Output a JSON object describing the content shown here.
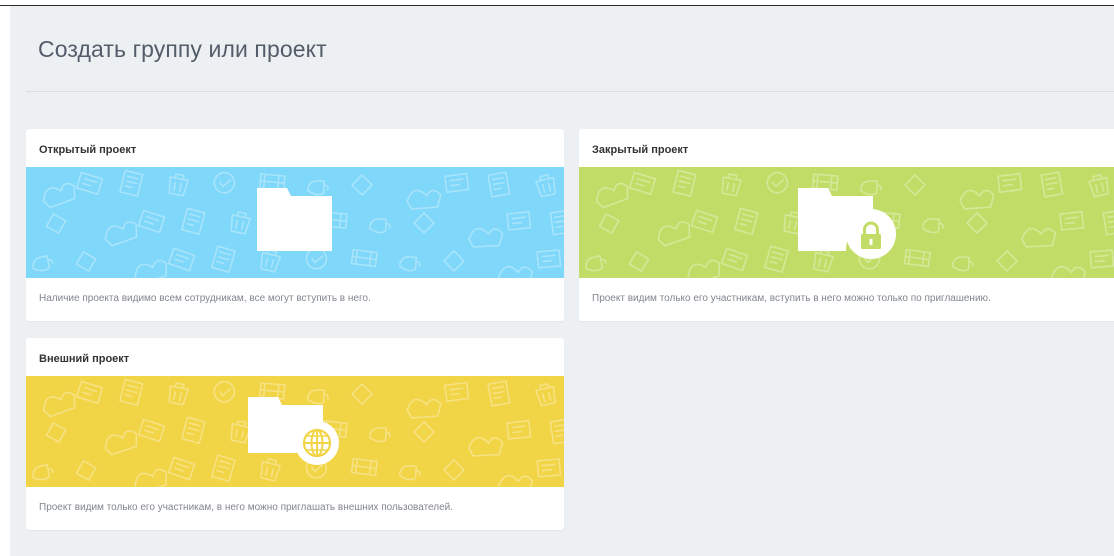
{
  "page": {
    "title": "Создать группу или проект"
  },
  "cards": [
    {
      "title": "Открытый проект",
      "description": "Наличие проекта видимо всем сотрудникам, все могут вступить в него.",
      "banner_color": "#7fd7f9",
      "icon": "folder-icon"
    },
    {
      "title": "Закрытый проект",
      "description": "Проект видим только его участникам, вступить в него можно только по приглашению.",
      "banner_color": "#c1dd68",
      "icon": "folder-lock-icon"
    },
    {
      "title": "Внешний проект",
      "description": "Проект видим только его участникам, в него можно приглашать внешних пользователей.",
      "banner_color": "#f2d447",
      "icon": "folder-globe-icon"
    }
  ]
}
